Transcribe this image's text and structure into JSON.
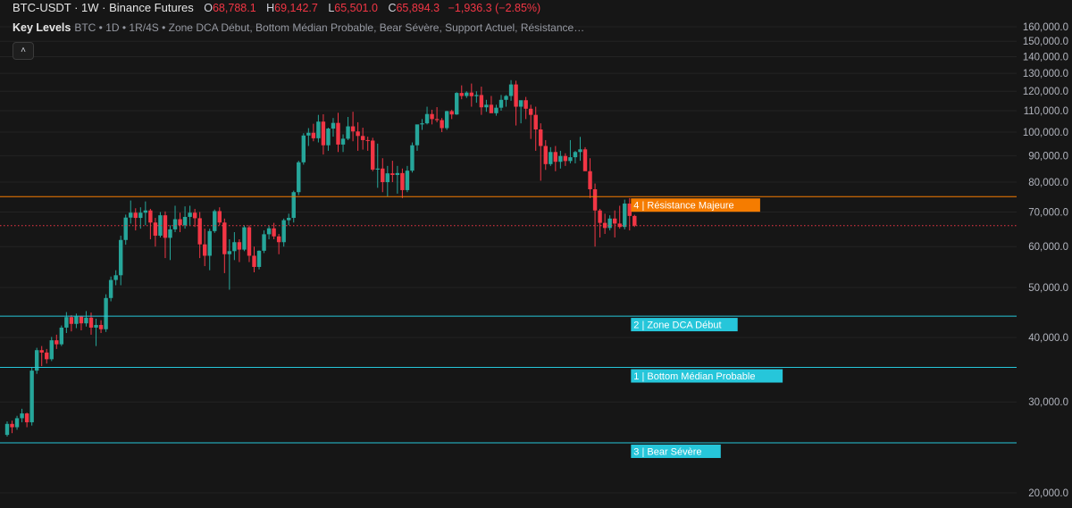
{
  "header": {
    "symbol": "BTC-USDT · 1W · Binance Futures",
    "o_label": "O",
    "o_value": "68,788.1",
    "h_label": "H",
    "h_value": "69,142.7",
    "l_label": "L",
    "l_value": "65,501.0",
    "c_label": "C",
    "c_value": "65,894.3",
    "change": "−1,936.3 (−2.85%)"
  },
  "indicator": {
    "name": "Key Levels",
    "args": "BTC • 1D • 1R/4S • Zone DCA Début, Bottom Médian Probable, Bear Sévère, Support Actuel, Résistance…",
    "collapse_icon": "chevron-up-icon"
  },
  "colors": {
    "up": "#26a69a",
    "down": "#f23645",
    "resistance": "#f57c00",
    "support": "#26c6da",
    "last_price": "#f23645",
    "background": "#161616"
  },
  "chart_data": {
    "type": "candlestick",
    "y_axis_labels": [
      "160,000.0",
      "150,000.0",
      "140,000.0",
      "130,000.0",
      "120,000.0",
      "110,000.0",
      "100,000.0",
      "90,000.0",
      "80,000.0",
      "70,000.0",
      "60,000.0",
      "50,000.0",
      "40,000.0",
      "30,000.0",
      "20,000.0"
    ],
    "y_ticks": [
      160000,
      150000,
      140000,
      130000,
      120000,
      110000,
      100000,
      90000,
      80000,
      70000,
      60000,
      50000,
      40000,
      30000,
      20000
    ],
    "ylim": [
      18000,
      168000
    ],
    "scale": "log",
    "levels": [
      {
        "value": 75000,
        "price_label": "75,000.0",
        "label": "4 | Résistance Majeure",
        "kind": "resistance"
      },
      {
        "value": 44000,
        "price_label": "44,000.0",
        "label": "2 | Zone DCA Début",
        "kind": "support"
      },
      {
        "value": 35000,
        "price_label": "35,000.0",
        "label": "1 | Bottom Médian Probable",
        "kind": "support"
      },
      {
        "value": 25000,
        "price_label": "25,000.0",
        "label": "3 | Bear Sévère",
        "kind": "support"
      }
    ],
    "last_price": {
      "value": 65894.3,
      "label": "65,894.3"
    },
    "candles": [
      [
        25900,
        27500,
        25700,
        27200
      ],
      [
        27200,
        27600,
        26100,
        26800
      ],
      [
        26800,
        28200,
        26500,
        27900
      ],
      [
        27900,
        29100,
        27400,
        28500
      ],
      [
        28500,
        28600,
        26800,
        27400
      ],
      [
        27400,
        35000,
        27000,
        34500
      ],
      [
        34500,
        38200,
        34000,
        37800
      ],
      [
        37800,
        38500,
        35200,
        37400
      ],
      [
        37400,
        38000,
        35600,
        36300
      ],
      [
        36300,
        40100,
        36000,
        39500
      ],
      [
        39500,
        40500,
        38000,
        38800
      ],
      [
        38800,
        42200,
        38500,
        41800
      ],
      [
        41800,
        44800,
        40800,
        43800
      ],
      [
        43800,
        44200,
        41100,
        42500
      ],
      [
        42500,
        44500,
        41700,
        43900
      ],
      [
        43900,
        44100,
        41300,
        42600
      ],
      [
        42600,
        45000,
        42000,
        43700
      ],
      [
        43700,
        44700,
        40500,
        41800
      ],
      [
        41800,
        43500,
        38500,
        42300
      ],
      [
        42300,
        43200,
        40800,
        41500
      ],
      [
        41500,
        48500,
        41000,
        47700
      ],
      [
        47700,
        52500,
        47000,
        51700
      ],
      [
        51700,
        54000,
        50500,
        52800
      ],
      [
        52800,
        63000,
        50500,
        61800
      ],
      [
        61800,
        69200,
        60500,
        68300
      ],
      [
        68300,
        73700,
        66500,
        69800
      ],
      [
        69800,
        71200,
        64500,
        68200
      ],
      [
        68200,
        71500,
        65000,
        69800
      ],
      [
        69800,
        73400,
        66000,
        70500
      ],
      [
        70500,
        71000,
        62000,
        66800
      ],
      [
        66800,
        68200,
        60000,
        63000
      ],
      [
        63000,
        70000,
        62500,
        69000
      ],
      [
        69000,
        70200,
        57000,
        62400
      ],
      [
        62400,
        66000,
        56500,
        64800
      ],
      [
        64800,
        72000,
        64000,
        67800
      ],
      [
        67800,
        69800,
        64000,
        66000
      ],
      [
        66000,
        71800,
        65000,
        68500
      ],
      [
        68500,
        72000,
        66000,
        69800
      ],
      [
        69800,
        71000,
        65500,
        68100
      ],
      [
        68100,
        70000,
        57000,
        60600
      ],
      [
        60600,
        65000,
        55000,
        57600
      ],
      [
        57600,
        65000,
        54000,
        64300
      ],
      [
        64300,
        70800,
        63800,
        70300
      ],
      [
        70300,
        71500,
        66000,
        66800
      ],
      [
        66800,
        68000,
        53300,
        58000
      ],
      [
        58000,
        62000,
        49500,
        58800
      ],
      [
        58800,
        64000,
        56500,
        61200
      ],
      [
        61200,
        62000,
        56000,
        59200
      ],
      [
        59200,
        66000,
        58800,
        65400
      ],
      [
        65400,
        66000,
        56000,
        57600
      ],
      [
        57600,
        60000,
        53500,
        54800
      ],
      [
        54800,
        59000,
        54200,
        58900
      ],
      [
        58900,
        64500,
        58300,
        63400
      ],
      [
        63400,
        66000,
        62000,
        65100
      ],
      [
        65100,
        66700,
        62000,
        62800
      ],
      [
        62800,
        63500,
        58000,
        61200
      ],
      [
        61200,
        68000,
        60000,
        67500
      ],
      [
        67500,
        69500,
        66000,
        68200
      ],
      [
        68200,
        77000,
        66800,
        76500
      ],
      [
        76500,
        88000,
        75500,
        87400
      ],
      [
        87400,
        99500,
        86500,
        98500
      ],
      [
        98500,
        101800,
        94000,
        99700
      ],
      [
        99700,
        103800,
        96000,
        97300
      ],
      [
        97300,
        108000,
        95500,
        104800
      ],
      [
        104800,
        108300,
        90500,
        94300
      ],
      [
        94300,
        102000,
        92000,
        101600
      ],
      [
        101600,
        106500,
        98000,
        104200
      ],
      [
        104200,
        109000,
        91500,
        94600
      ],
      [
        94600,
        99000,
        91500,
        97100
      ],
      [
        97100,
        107000,
        96500,
        102600
      ],
      [
        102600,
        109500,
        96000,
        100300
      ],
      [
        100300,
        104500,
        92000,
        98300
      ],
      [
        98300,
        102000,
        92500,
        96500
      ],
      [
        96500,
        98000,
        92000,
        96300
      ],
      [
        96300,
        97500,
        84000,
        84600
      ],
      [
        84600,
        95000,
        78000,
        85000
      ],
      [
        85000,
        89000,
        76500,
        80000
      ],
      [
        80000,
        86000,
        75000,
        83200
      ],
      [
        83200,
        88000,
        80000,
        82600
      ],
      [
        82600,
        86000,
        76000,
        83300
      ],
      [
        83300,
        85000,
        74500,
        77200
      ],
      [
        77200,
        86000,
        76500,
        84200
      ],
      [
        84200,
        95500,
        83500,
        94300
      ],
      [
        94300,
        97500,
        92000,
        103500
      ],
      [
        103500,
        106000,
        101000,
        104000
      ],
      [
        104000,
        112000,
        103500,
        108400
      ],
      [
        108400,
        110500,
        103500,
        106000
      ],
      [
        106000,
        111800,
        104500,
        105500
      ],
      [
        105500,
        106500,
        100000,
        101800
      ],
      [
        101800,
        110000,
        101000,
        109800
      ],
      [
        109800,
        110500,
        106000,
        108200
      ],
      [
        108200,
        119500,
        108000,
        119100
      ],
      [
        119100,
        123200,
        115800,
        117500
      ],
      [
        117500,
        120000,
        116500,
        119300
      ],
      [
        119300,
        124200,
        112000,
        117400
      ],
      [
        117400,
        120000,
        114000,
        118000
      ],
      [
        118000,
        122500,
        108000,
        111700
      ],
      [
        111700,
        115500,
        109500,
        113000
      ],
      [
        113000,
        117500,
        110500,
        108800
      ],
      [
        108800,
        113000,
        107600,
        111500
      ],
      [
        111500,
        118000,
        110000,
        115500
      ],
      [
        115500,
        118000,
        112000,
        117500
      ],
      [
        117500,
        126100,
        115000,
        123700
      ],
      [
        123700,
        125800,
        103000,
        112000
      ],
      [
        112000,
        115000,
        104000,
        115300
      ],
      [
        115300,
        117000,
        106000,
        111000
      ],
      [
        111000,
        113000,
        97000,
        108000
      ],
      [
        108000,
        112000,
        92000,
        101200
      ],
      [
        101200,
        104000,
        80500,
        94000
      ],
      [
        94000,
        96500,
        84500,
        86700
      ],
      [
        86700,
        93500,
        86000,
        91500
      ],
      [
        91500,
        94000,
        84000,
        87600
      ],
      [
        87600,
        92000,
        85000,
        89900
      ],
      [
        89900,
        91000,
        86000,
        87900
      ],
      [
        87900,
        96500,
        87000,
        89400
      ],
      [
        89400,
        92000,
        87000,
        91500
      ],
      [
        91500,
        97900,
        88000,
        92600
      ],
      [
        92600,
        93500,
        86000,
        84000
      ],
      [
        84000,
        89000,
        74500,
        77500
      ],
      [
        77500,
        79500,
        60000,
        70500
      ],
      [
        70500,
        71000,
        62500,
        66700
      ],
      [
        66700,
        69500,
        63500,
        65200
      ],
      [
        65200,
        69000,
        64500,
        68000
      ],
      [
        68000,
        70500,
        62500,
        66500
      ],
      [
        66500,
        72000,
        65000,
        65500
      ],
      [
        65500,
        74000,
        64800,
        72700
      ],
      [
        72700,
        74500,
        64500,
        68800
      ],
      [
        68800,
        69143,
        65501,
        65894.3
      ]
    ]
  }
}
